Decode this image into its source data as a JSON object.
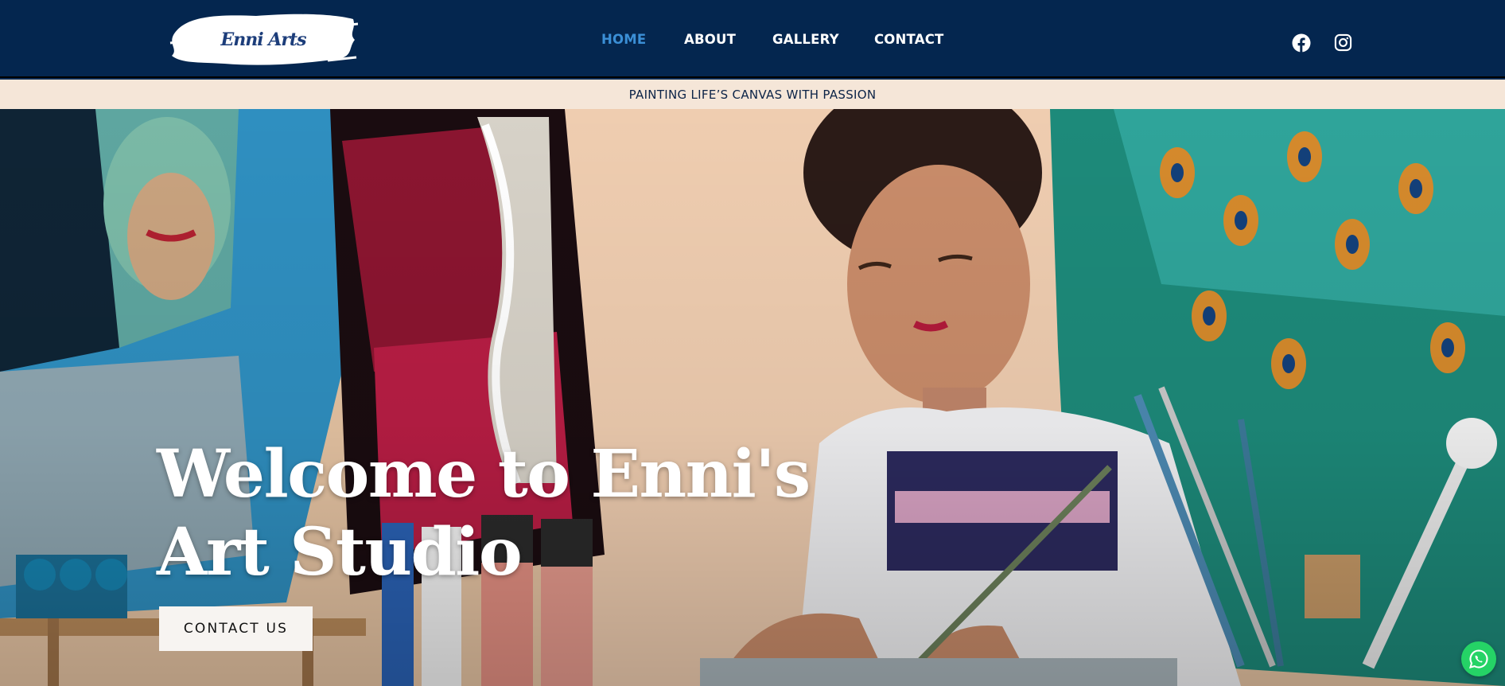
{
  "brand": {
    "logo_text": "Enni Arts"
  },
  "nav": {
    "items": [
      {
        "label": "HOME",
        "active": true
      },
      {
        "label": "ABOUT",
        "active": false
      },
      {
        "label": "GALLERY",
        "active": false
      },
      {
        "label": "CONTACT",
        "active": false
      }
    ]
  },
  "social": {
    "icons": [
      "facebook-icon",
      "instagram-icon"
    ]
  },
  "tagline": "PAINTING LIFE’S CANVAS WITH PASSION",
  "hero": {
    "title_line1": "Welcome to Enni's",
    "title_line2": "Art Studio",
    "cta_label": "CONTACT US"
  },
  "floating": {
    "icon": "whatsapp-icon"
  },
  "colors": {
    "header_bg": "#04264f",
    "nav_active": "#3b8fd6",
    "tagline_bg": "#f5e6d8",
    "tagline_text": "#0b2347",
    "whatsapp": "#25d366"
  }
}
